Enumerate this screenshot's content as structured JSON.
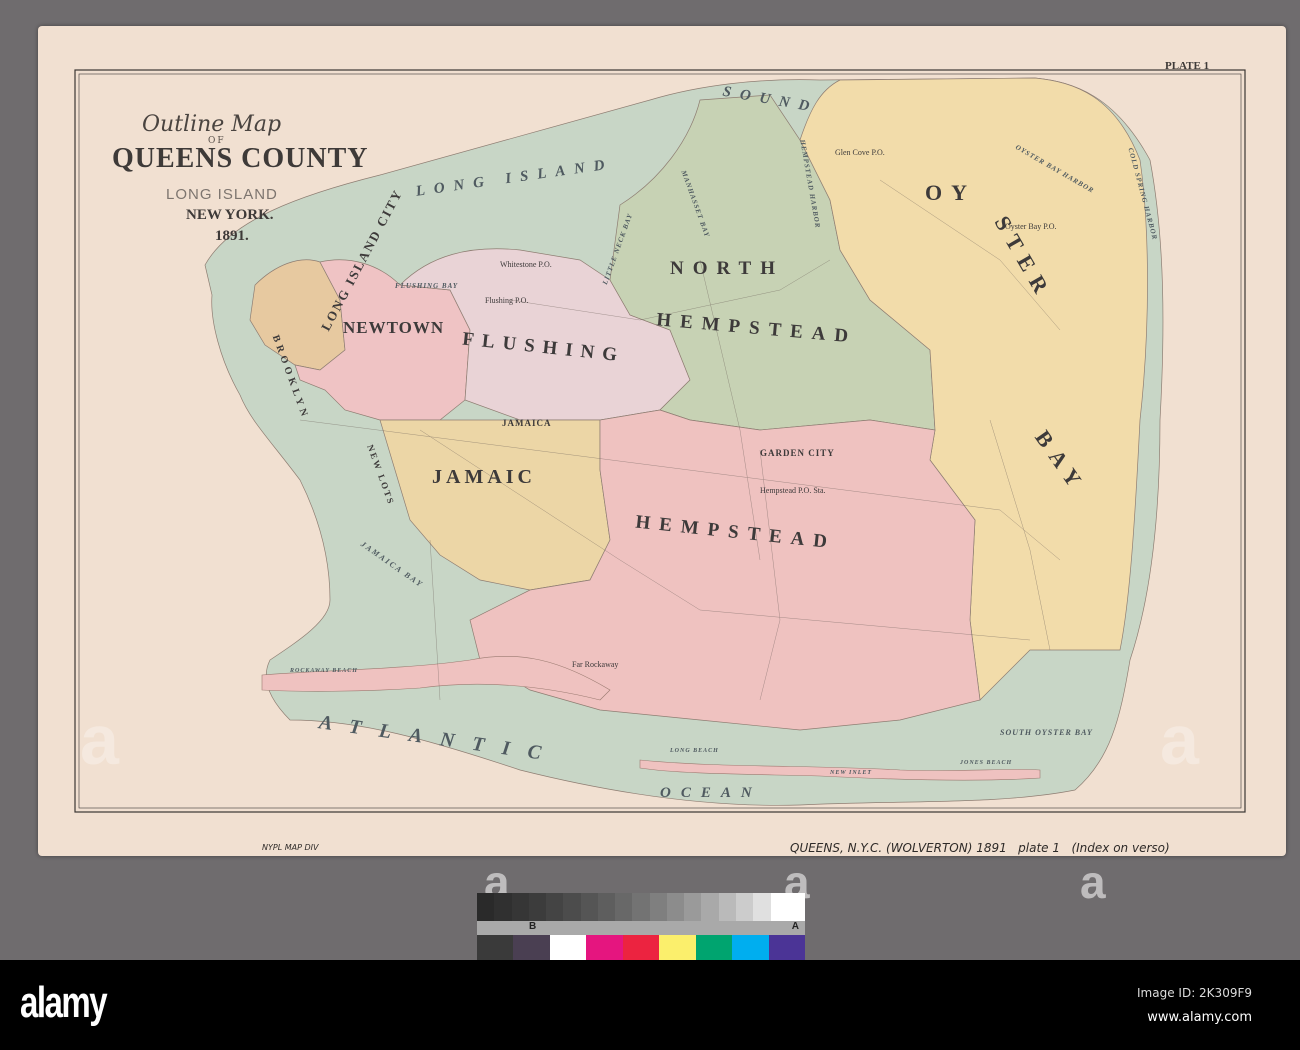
{
  "map": {
    "title_line1": "Outline Map",
    "title_of": "OF",
    "title_line2": "QUEENS COUNTY",
    "title_line3": "LONG ISLAND",
    "title_line4": "NEW YORK.",
    "title_line5": "1891.",
    "plate": "PLATE 1",
    "regions": {
      "long_island_city": "LONG ISLAND CITY",
      "newtown": "NEWTOWN",
      "flushing": "FLUSHING",
      "north": "NORTH",
      "north_hempstead": "HEMPSTEAD",
      "oyster_bay_1": "OY",
      "oyster_bay_2": "STER",
      "oyster_bay_3": "BAY",
      "jamaica": "JAMAIC",
      "hempstead": "HEMPSTEAD",
      "garden_city": "GARDEN CITY",
      "brooklyn": "BROOKLYN",
      "new_lots": "NEW LOTS"
    },
    "water": {
      "long_island": "LONG ISLAND",
      "sound": "SOUND",
      "atlantic": "ATLANTIC",
      "ocean": "OCEAN",
      "jamaica_bay": "JAMAICA BAY",
      "flushing_bay": "FLUSHING BAY",
      "little_neck_bay": "LITTLE NECK BAY",
      "manhasset_bay": "MANHASSET BAY",
      "hempstead_harbor": "HEMPSTEAD HARBOR",
      "oyster_bay_harbor": "OYSTER BAY HARBOR",
      "cold_spring_harbor": "COLD SPRING HARBOR",
      "south_oyster_bay": "SOUTH OYSTER BAY",
      "rockaway_beach": "ROCKAWAY BEACH",
      "long_beach": "LONG BEACH",
      "jones_beach": "JONES BEACH",
      "new_inlet": "NEW INLET"
    },
    "places": {
      "jamaica_town": "JAMAICA",
      "hempstead_po": "Hempstead P.O. Sta.",
      "flushing_po": "Flushing P.O.",
      "whitestone": "Whitestone P.O.",
      "glen_cove": "Glen Cove P.O.",
      "oyster_bay_po": "Oyster Bay P.O.",
      "far_rockaway": "Far Rockaway"
    }
  },
  "annotations": {
    "left": "NYPL MAP DIV",
    "right": "QUEENS, N.Y.C. (WOLVERTON) 1891   plate 1   (Index on verso)"
  },
  "color_target": {
    "letter_b": "B",
    "letter_a": "A",
    "grays": [
      "#2a2a2a",
      "#303030",
      "#363636",
      "#3c3c3c",
      "#444444",
      "#4c4c4c",
      "#555555",
      "#5e5e5e",
      "#686868",
      "#737373",
      "#7f7f7f",
      "#8c8c8c",
      "#9a9a9a",
      "#a9a9a9",
      "#bababa",
      "#cccccc",
      "#e0e0e0",
      "#ffffff",
      "#ffffff"
    ],
    "colors": [
      "#3a3a3a",
      "#4a3f52",
      "#ffffff",
      "#e5157f",
      "#ec2340",
      "#fbef6c",
      "#00a46f",
      "#00aeef",
      "#4b3496"
    ]
  },
  "watermark": {
    "glyph": "a"
  },
  "footer": {
    "logo": "alamy",
    "image_id": "Image ID: 2K309F9",
    "site": "www.alamy.com"
  },
  "colors": {
    "water": "#c8d6c6",
    "newtown": "#efc3c4",
    "flushing": "#e9d3d6",
    "north_hempstead": "#c7d2b4",
    "oyster_bay": "#f2dcaa",
    "jamaica": "#ecd6a6",
    "hempstead": "#efc2c0",
    "lic": "#e7c9a0"
  }
}
